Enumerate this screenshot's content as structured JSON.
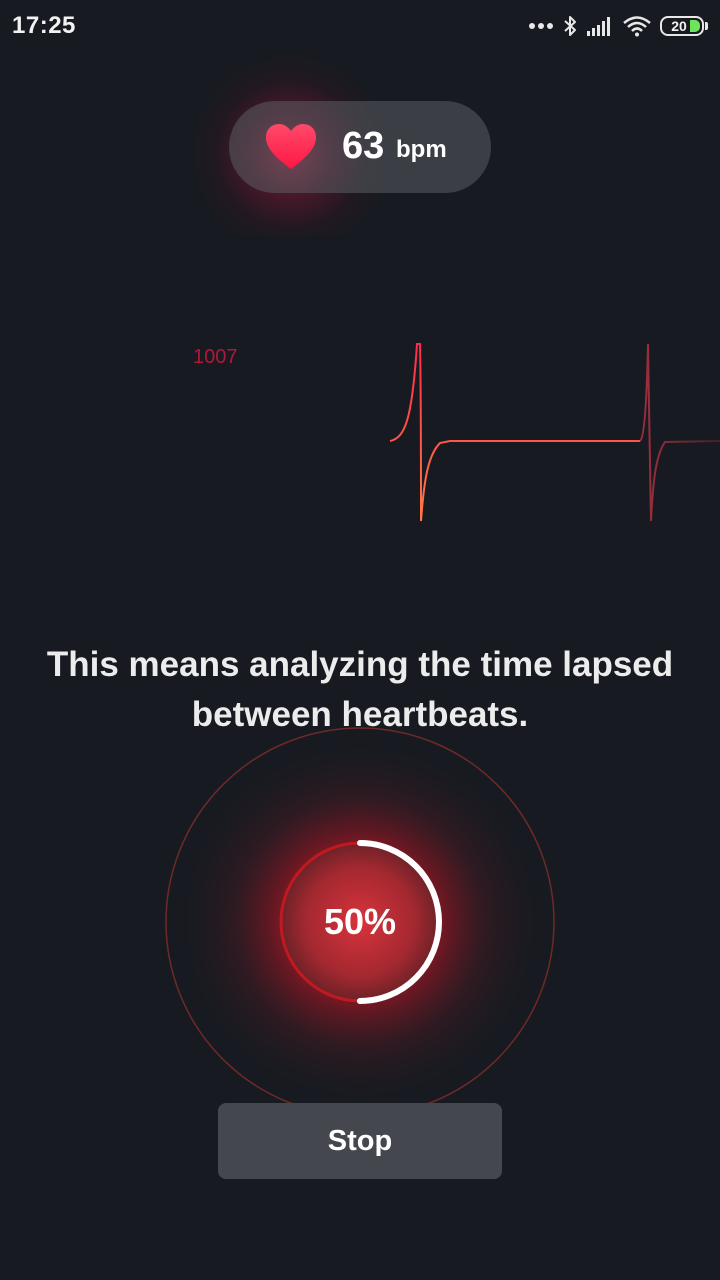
{
  "status_bar": {
    "time": "17:25",
    "battery_level": "20",
    "icons": [
      "more-dots-icon",
      "bluetooth-icon",
      "signal-icon",
      "wifi-icon",
      "battery-icon"
    ]
  },
  "heart_rate": {
    "value": "63",
    "unit": "bpm",
    "icon": "heart-icon"
  },
  "ecg": {
    "label": "1007"
  },
  "message": "This means analyzing the time lapsed between heartbeats.",
  "progress": {
    "label": "50%",
    "fraction": 0.5
  },
  "stop_label": "Stop",
  "colors": {
    "background": "#171a21",
    "accent": "#e8213f",
    "battery": "#6ee35c",
    "button": "#45474e"
  }
}
